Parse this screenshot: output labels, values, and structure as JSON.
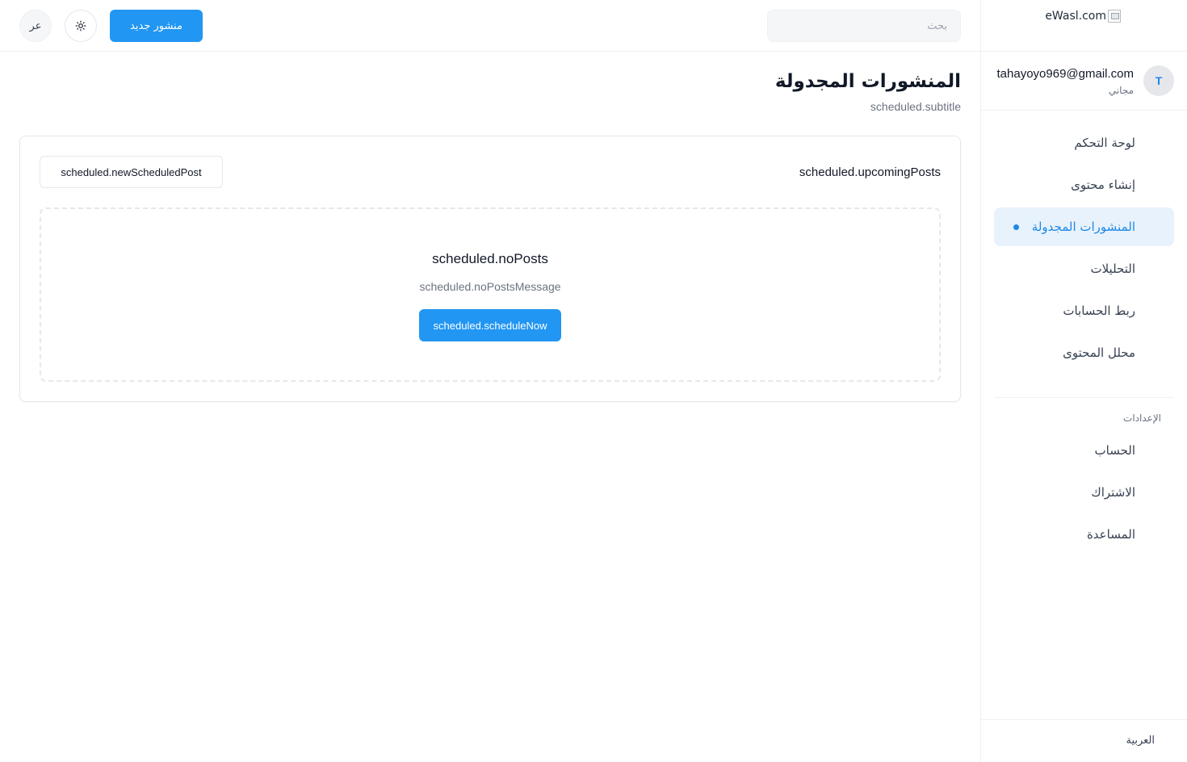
{
  "brand": {
    "logo_text": "eWasl.com"
  },
  "user": {
    "avatar_initial": "T",
    "email": "tahayoyo969@gmail.com",
    "plan": "مجاني"
  },
  "sidebar": {
    "items": [
      {
        "label": "لوحة التحكم",
        "active": false
      },
      {
        "label": "إنشاء محتوى",
        "active": false
      },
      {
        "label": "المنشورات المجدولة",
        "active": true
      },
      {
        "label": "التحليلات",
        "active": false
      },
      {
        "label": "ربط الحسابات",
        "active": false
      },
      {
        "label": "محلل المحتوى",
        "active": false
      }
    ],
    "settings_title": "الإعدادات",
    "settings_items": [
      {
        "label": "الحساب"
      },
      {
        "label": "الاشتراك"
      },
      {
        "label": "المساعدة"
      }
    ],
    "footer_language": "العربية"
  },
  "topbar": {
    "search_placeholder": "بحث",
    "new_post_label": "منشور جديد",
    "theme_icon": "sun-icon",
    "lang_toggle": "عر"
  },
  "main": {
    "title": "المنشورات المجدولة",
    "subtitle": "scheduled.subtitle",
    "card": {
      "title": "scheduled.upcomingPosts",
      "new_button": "scheduled.newScheduledPost",
      "empty_title": "scheduled.noPosts",
      "empty_message": "scheduled.noPostsMessage",
      "schedule_now": "scheduled.scheduleNow"
    }
  },
  "colors": {
    "accent": "#2196f3",
    "active_bg": "#e8f2fd"
  }
}
